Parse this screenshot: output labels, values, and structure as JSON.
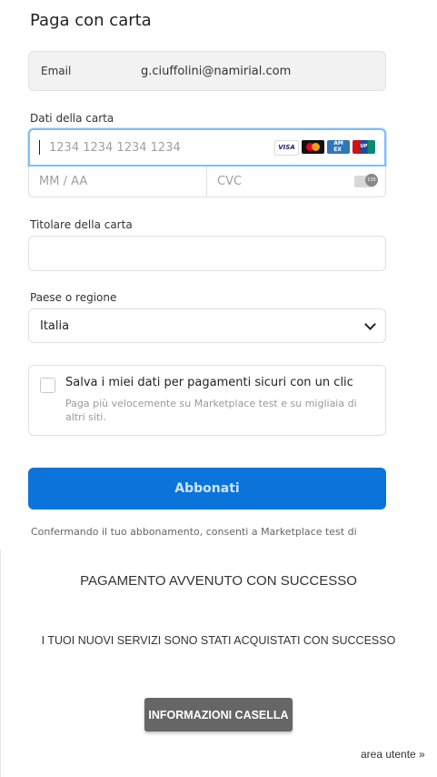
{
  "checkout": {
    "title": "Paga con carta",
    "email_label": "Email",
    "email_value": "g.ciuffolini@namirial.com",
    "card_section_label": "Dati della carta",
    "card_number_placeholder": "1234 1234 1234 1234",
    "card_brands": [
      "VISA",
      "Mastercard",
      "American Express",
      "UnionPay"
    ],
    "expiry_placeholder": "MM / AA",
    "cvc_placeholder": "CVC",
    "holder_label": "Titolare della carta",
    "holder_value": "",
    "country_label": "Paese o regione",
    "country_value": "Italia",
    "save_title": "Salva i miei dati per pagamenti sicuri con un clic",
    "save_subtitle": "Paga più velocemente su Marketplace test e su migliaia di altri siti.",
    "save_checked": false,
    "submit_label": "Abbonati",
    "confirm_text": "Confermando il tuo abbonamento, consenti a Marketplace test di",
    "accent_color": "#0a74da"
  },
  "success": {
    "title": "PAGAMENTO AVVENUTO CON SUCCESSO",
    "subtitle": "I TUOI NUOVI SERVIZI SONO STATI ACQUISTATI CON SUCCESSO",
    "info_button_label": "INFORMAZIONI CASELLA",
    "area_link_label": "area utente »"
  }
}
